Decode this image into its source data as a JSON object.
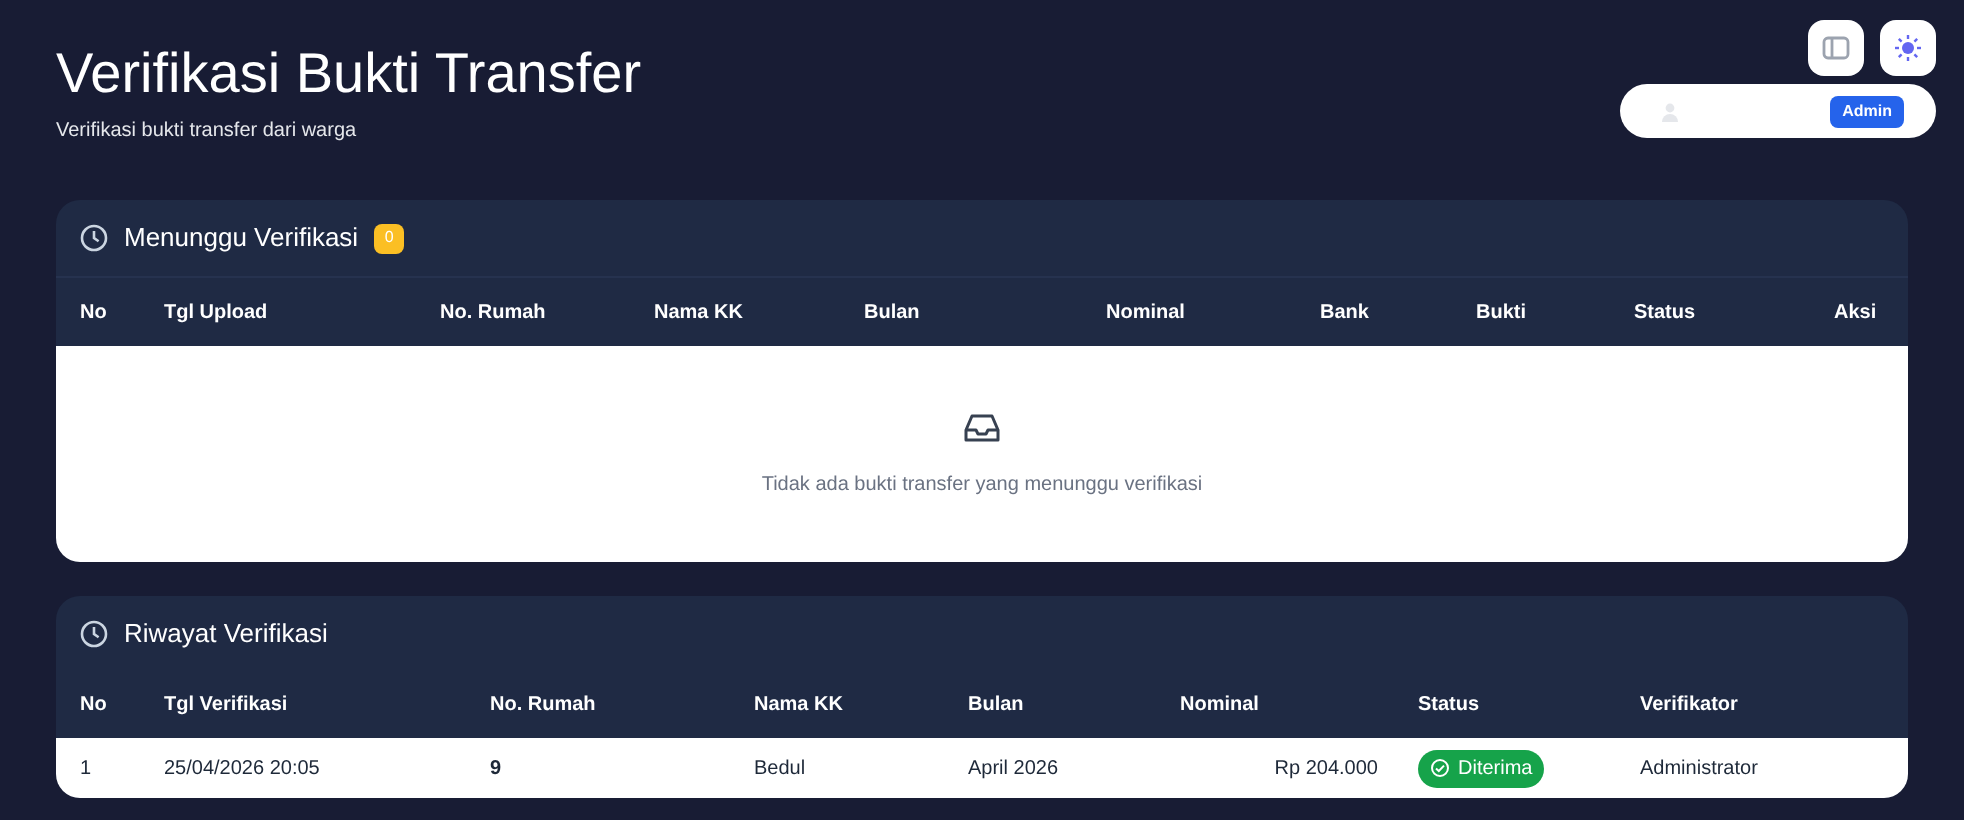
{
  "header": {
    "title": "Verifikasi Bukti Transfer",
    "subtitle": "Verifikasi bukti transfer dari warga"
  },
  "user": {
    "role": "Admin"
  },
  "pending": {
    "title": "Menunggu Verifikasi",
    "count": "0",
    "columns": [
      "No",
      "Tgl Upload",
      "No. Rumah",
      "Nama KK",
      "Bulan",
      "Nominal",
      "Bank",
      "Bukti",
      "Status",
      "Aksi"
    ],
    "empty_message": "Tidak ada bukti transfer yang menunggu verifikasi"
  },
  "history": {
    "title": "Riwayat Verifikasi",
    "columns": [
      "No",
      "Tgl Verifikasi",
      "No. Rumah",
      "Nama KK",
      "Bulan",
      "Nominal",
      "Status",
      "Verifikator"
    ],
    "rows": [
      {
        "no": "1",
        "date": "25/04/2026 20:05",
        "house": "9",
        "name": "Bedul",
        "month": "April 2026",
        "amount": "Rp 204.000",
        "status": {
          "label": "Diterima",
          "kind": "accepted"
        },
        "verifier": "Administrator"
      }
    ]
  }
}
